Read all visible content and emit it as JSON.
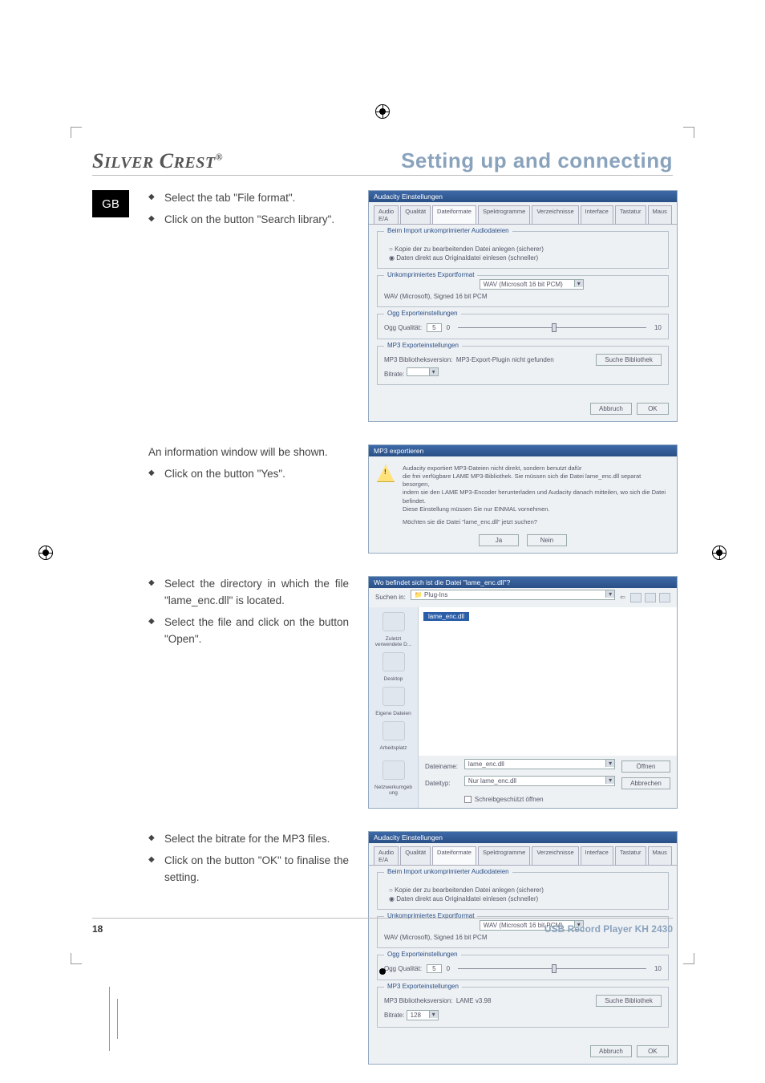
{
  "header": {
    "brand": "SilverCrest®",
    "section": "Setting up and connecting"
  },
  "lang_tab": "GB",
  "blocks": [
    {
      "intro": null,
      "bullets": [
        "Select the tab \"File format\".",
        "Click on the button \"Search library\"."
      ]
    },
    {
      "intro": "An information window will be shown.",
      "bullets": [
        "Click on the button \"Yes\"."
      ]
    },
    {
      "intro": null,
      "bullets": [
        "Select the directory in which the file \"lame_enc.dll\" is located.",
        "Select the file and click on the button \"Open\"."
      ]
    },
    {
      "intro": null,
      "bullets": [
        "Select the bitrate for the MP3 files.",
        "Click on the button \"OK\" to finalise the setting."
      ]
    }
  ],
  "dlg1": {
    "title": "Audacity Einstellungen",
    "tabs": [
      "Audio E/A",
      "Qualität",
      "Dateiformate",
      "Spektrogramme",
      "Verzeichnisse",
      "Interface",
      "Tastatur",
      "Maus"
    ],
    "active_tab": "Dateiformate",
    "grp1_label": "Beim Import unkomprimierter Audiodateien",
    "radio1": "Kopie der zu bearbeitenden Datei anlegen (sicherer)",
    "radio2": "Daten direkt aus Originaldatei einlesen (schneller)",
    "grp2_label": "Unkomprimiertes Exportformat",
    "format_select": "WAV (Microsoft 16 bit PCM)",
    "format_line": "WAV (Microsoft), Signed 16 bit PCM",
    "grp3_label": "Ogg Exporteinstellungen",
    "ogg_label": "Ogg Qualität:",
    "ogg_low": "0",
    "ogg_val": "5",
    "ogg_high": "10",
    "grp4_label": "MP3 Exporteinstellungen",
    "mp3_lib_label": "MP3 Bibliotheksversion:",
    "mp3_lib_value": "MP3-Export-Plugin nicht gefunden",
    "search_btn": "Suche Bibliothek",
    "bitrate_label": "Bitrate:",
    "bitrate_sel": " ",
    "cancel": "Abbruch",
    "ok": "OK"
  },
  "msgbox": {
    "title": "MP3 exportieren",
    "msg": "Audacity exportiert MP3-Dateien nicht direkt, sondern benutzt dafür\ndie frei verfügbare LAME MP3-Bibliothek. Sie müssen sich die Datei lame_enc.dll separat besorgen,\nindem sie den LAME MP3-Encoder herunterladen und Audacity danach mitteilen, wo sich die Datei befindet.\nDiese Einstellung müssen Sie nur EINMAL vornehmen.",
    "q": "Möchten sie die Datei \"lame_enc.dll\" jetzt suchen?",
    "yes": "Ja",
    "no": "Nein"
  },
  "filedlg": {
    "title": "Wo befindet sich ist die Datei   \"lame_enc.dll\"?",
    "lookin_label": "Suchen in:",
    "lookin_value": "Plug-Ins",
    "places": [
      "Zuletzt verwendete D...",
      "Desktop",
      "Eigene Dateien",
      "Arbeitsplatz",
      "Netzwerkumgeb ung"
    ],
    "file_selected": "lame_enc.dll",
    "name_label": "Dateiname:",
    "name_value": "lame_enc.dll",
    "type_label": "Dateityp:",
    "type_value": "Nur lame_enc.dll",
    "readonly": "Schreibgeschützt öffnen",
    "open": "Öffnen",
    "cancel": "Abbrechen"
  },
  "dlg2": {
    "title": "Audacity Einstellungen",
    "mp3_lib_value": "LAME v3.98",
    "bitrate_sel": "128"
  },
  "footer": {
    "page": "18",
    "product": "USB Record Player KH 2430"
  }
}
